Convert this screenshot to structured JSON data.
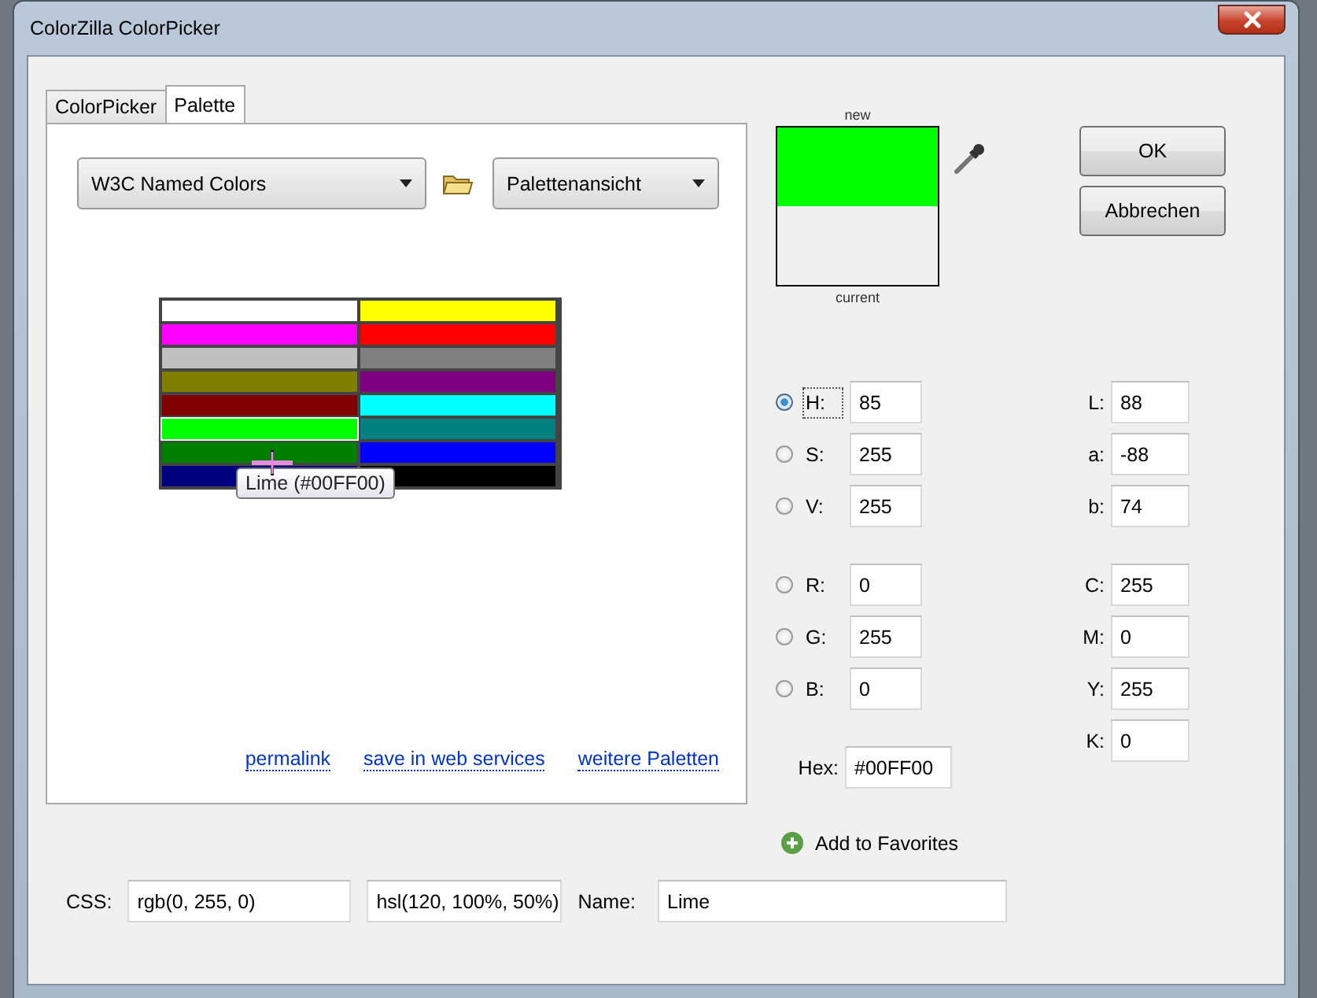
{
  "window": {
    "title": "ColorZilla ColorPicker"
  },
  "tabs": [
    {
      "label": "ColorPicker",
      "selected": false
    },
    {
      "label": "Palette",
      "selected": true
    }
  ],
  "palette_select": {
    "value": "W3C Named Colors"
  },
  "view_select": {
    "value": "Palettenansicht"
  },
  "swatches": [
    {
      "color": "#ffffff",
      "selected": false
    },
    {
      "color": "#ffff00",
      "selected": false
    },
    {
      "color": "#ff00ff",
      "selected": false
    },
    {
      "color": "#ff0000",
      "selected": false
    },
    {
      "color": "#c0c0c0",
      "selected": false
    },
    {
      "color": "#808080",
      "selected": false
    },
    {
      "color": "#808000",
      "selected": false
    },
    {
      "color": "#800080",
      "selected": false
    },
    {
      "color": "#800000",
      "selected": false
    },
    {
      "color": "#00ffff",
      "selected": false
    },
    {
      "color": "#00ff00",
      "selected": true
    },
    {
      "color": "#008080",
      "selected": false
    },
    {
      "color": "#008000",
      "selected": false
    },
    {
      "color": "#0000ff",
      "selected": false
    },
    {
      "color": "#000080",
      "selected": false
    },
    {
      "color": "#000000",
      "selected": false
    }
  ],
  "tooltip": "Lime (#00FF00)",
  "links": [
    "permalink",
    "save in web services",
    "weitere Paletten"
  ],
  "preview": {
    "new_label": "new",
    "current_label": "current",
    "color": "#00ff00"
  },
  "buttons": [
    "OK",
    "Abbrechen"
  ],
  "hsv_fields": [
    {
      "label": "H:",
      "value": "85",
      "selected": true
    },
    {
      "label": "S:",
      "value": "255",
      "selected": false
    },
    {
      "label": "V:",
      "value": "255",
      "selected": false
    }
  ],
  "lab_fields": [
    {
      "label": "L:",
      "value": "88"
    },
    {
      "label": "a:",
      "value": "-88"
    },
    {
      "label": "b:",
      "value": "74"
    }
  ],
  "rgb_fields": [
    {
      "label": "R:",
      "value": "0",
      "selected": false
    },
    {
      "label": "G:",
      "value": "255",
      "selected": false
    },
    {
      "label": "B:",
      "value": "0",
      "selected": false
    }
  ],
  "cmyk_fields": [
    {
      "label": "C:",
      "value": "255"
    },
    {
      "label": "M:",
      "value": "0"
    },
    {
      "label": "Y:",
      "value": "255"
    },
    {
      "label": "K:",
      "value": "0"
    }
  ],
  "hex": {
    "label": "Hex:",
    "value": "#00FF00"
  },
  "add_favorites": "Add to Favorites",
  "css_row": {
    "label": "CSS:",
    "rgb": "rgb(0, 255, 0)",
    "hsl": "hsl(120, 100%, 50%)",
    "name_label": "Name:",
    "name": "Lime"
  }
}
